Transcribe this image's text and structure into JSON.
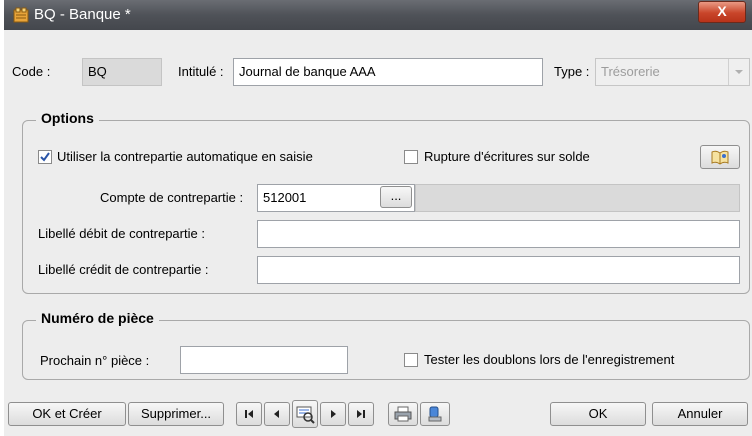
{
  "window": {
    "title": "BQ - Banque *",
    "close_label": "X"
  },
  "header": {
    "code_label": "Code :",
    "code_value": "BQ",
    "intitule_label": "Intitulé :",
    "intitule_value": "Journal de banque AAA",
    "type_label": "Type :",
    "type_value": "Trésorerie"
  },
  "options": {
    "title": "Options",
    "auto_contrepartie_label": "Utiliser la contrepartie automatique en saisie",
    "auto_contrepartie_checked": true,
    "rupture_label": "Rupture d'écritures sur solde",
    "rupture_checked": false,
    "compte_label": "Compte de contrepartie :",
    "compte_value": "512001",
    "browse_label": "...",
    "libelle_debit_label": "Libellé débit de contrepartie :",
    "libelle_debit_value": "",
    "libelle_credit_label": "Libellé crédit de contrepartie :",
    "libelle_credit_value": ""
  },
  "piece": {
    "title": "Numéro de pièce",
    "prochain_label": "Prochain n° pièce :",
    "prochain_value": "",
    "doublons_label": "Tester les doublons lors de l'enregistrement",
    "doublons_checked": false
  },
  "footer": {
    "ok_creer": "OK et Créer",
    "supprimer": "Supprimer...",
    "ok": "OK",
    "annuler": "Annuler"
  },
  "icons": {
    "title": "journal-icon",
    "help": "book-icon",
    "nav_first": "first-record-icon",
    "nav_prev": "previous-record-icon",
    "nav_search": "search-list-icon",
    "nav_next": "next-record-icon",
    "nav_last": "last-record-icon",
    "print": "printer-icon",
    "export": "export-icon"
  },
  "colors": {
    "titlebar": "#4f5258",
    "close": "#c9452a",
    "window_bg": "#ededed"
  }
}
